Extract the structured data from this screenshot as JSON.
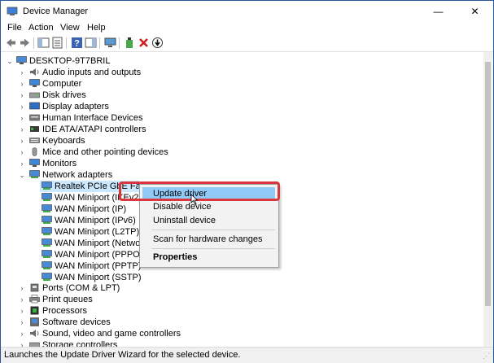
{
  "window": {
    "title": "Device Manager",
    "controls": {
      "minimize": "—",
      "maximize": "☐",
      "close": "✕"
    }
  },
  "menu": [
    "File",
    "Action",
    "View",
    "Help"
  ],
  "tree": {
    "root": "DESKTOP-9T7BRIL",
    "categories": [
      "Audio inputs and outputs",
      "Computer",
      "Disk drives",
      "Display adapters",
      "Human Interface Devices",
      "IDE ATA/ATAPI controllers",
      "Keyboards",
      "Mice and other pointing devices",
      "Monitors",
      "Network adapters"
    ],
    "network_children": [
      "Realtek PCIe GbE Fam",
      "WAN Miniport (IKEv2)",
      "WAN Miniport (IP)",
      "WAN Miniport (IPv6)",
      "WAN Miniport (L2TP)",
      "WAN Miniport (Netwo",
      "WAN Miniport (PPPOE",
      "WAN Miniport (PPTP)",
      "WAN Miniport (SSTP)"
    ],
    "categories_after": [
      "Ports (COM & LPT)",
      "Print queues",
      "Processors",
      "Software devices",
      "Sound, video and game controllers",
      "Storage controllers"
    ]
  },
  "context_menu": {
    "update_driver": "Update driver",
    "disable_device": "Disable device",
    "uninstall_device": "Uninstall device",
    "scan": "Scan for hardware changes",
    "properties": "Properties"
  },
  "status": "Launches the Update Driver Wizard for the selected device.",
  "colors": {
    "highlight_box": "#d9363e",
    "menu_highlight": "#91c9f7",
    "selection": "#cce8ff"
  }
}
